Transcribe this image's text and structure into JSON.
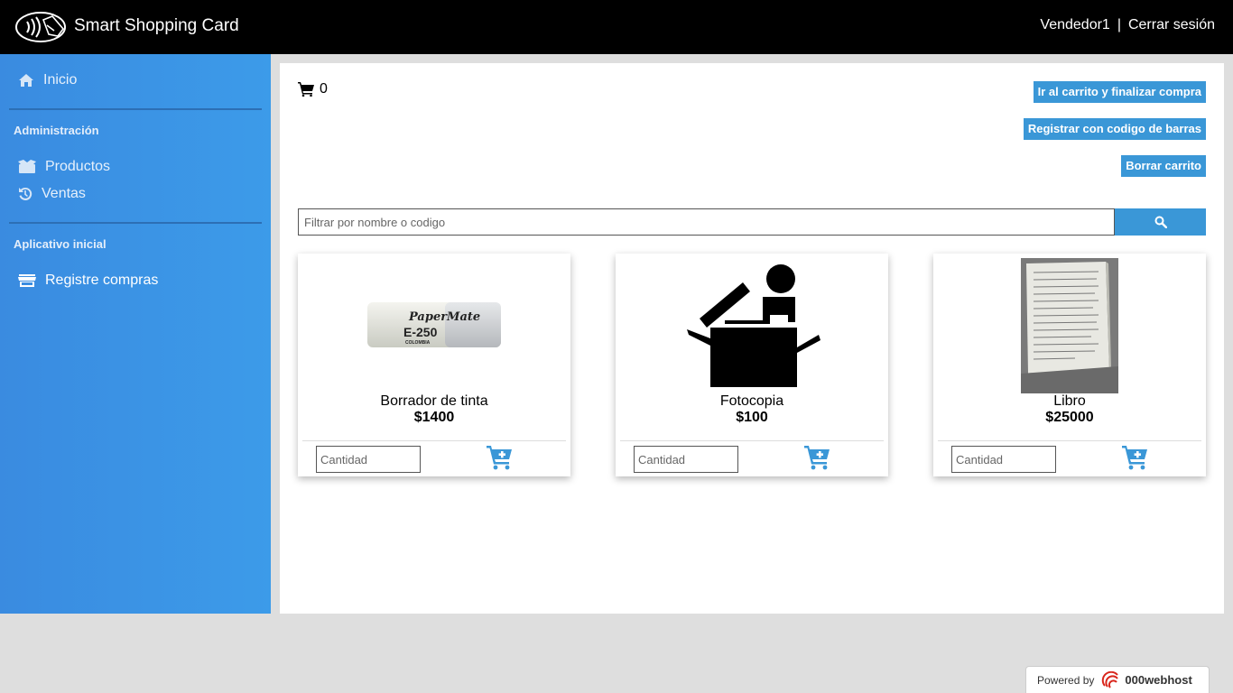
{
  "header": {
    "title": "Smart Shopping Card",
    "user": "Vendedor1",
    "separator": "|",
    "logout_label": "Cerrar sesión"
  },
  "sidebar": {
    "home_label": "Inicio",
    "admin_section": "Administración",
    "products_label": "Productos",
    "sales_label": "Ventas",
    "app_section": "Aplicativo inicial",
    "register_label": "Registre compras"
  },
  "main": {
    "cart_count": "0",
    "checkout_label": "Ir al carrito y finalizar compra",
    "barcode_label": "Registrar con codigo de barras",
    "clear_label": "Borrar carrito",
    "search_placeholder": "Filtrar por nombre o codigo",
    "quantity_placeholder": "Cantidad"
  },
  "products": [
    {
      "name": "Borrador de tinta",
      "price": "$1400",
      "image_brand": "PaperMate",
      "image_model": "E-250",
      "image_sub": "COLOMBIA"
    },
    {
      "name": "Fotocopia",
      "price": "$100"
    },
    {
      "name": "Libro",
      "price": "$25000"
    }
  ],
  "footer": {
    "powered_by": "Powered by",
    "host": "000webhost"
  },
  "colors": {
    "accent": "#3a97d7",
    "sidebar": "#3c9be9",
    "topbar": "#000000"
  }
}
